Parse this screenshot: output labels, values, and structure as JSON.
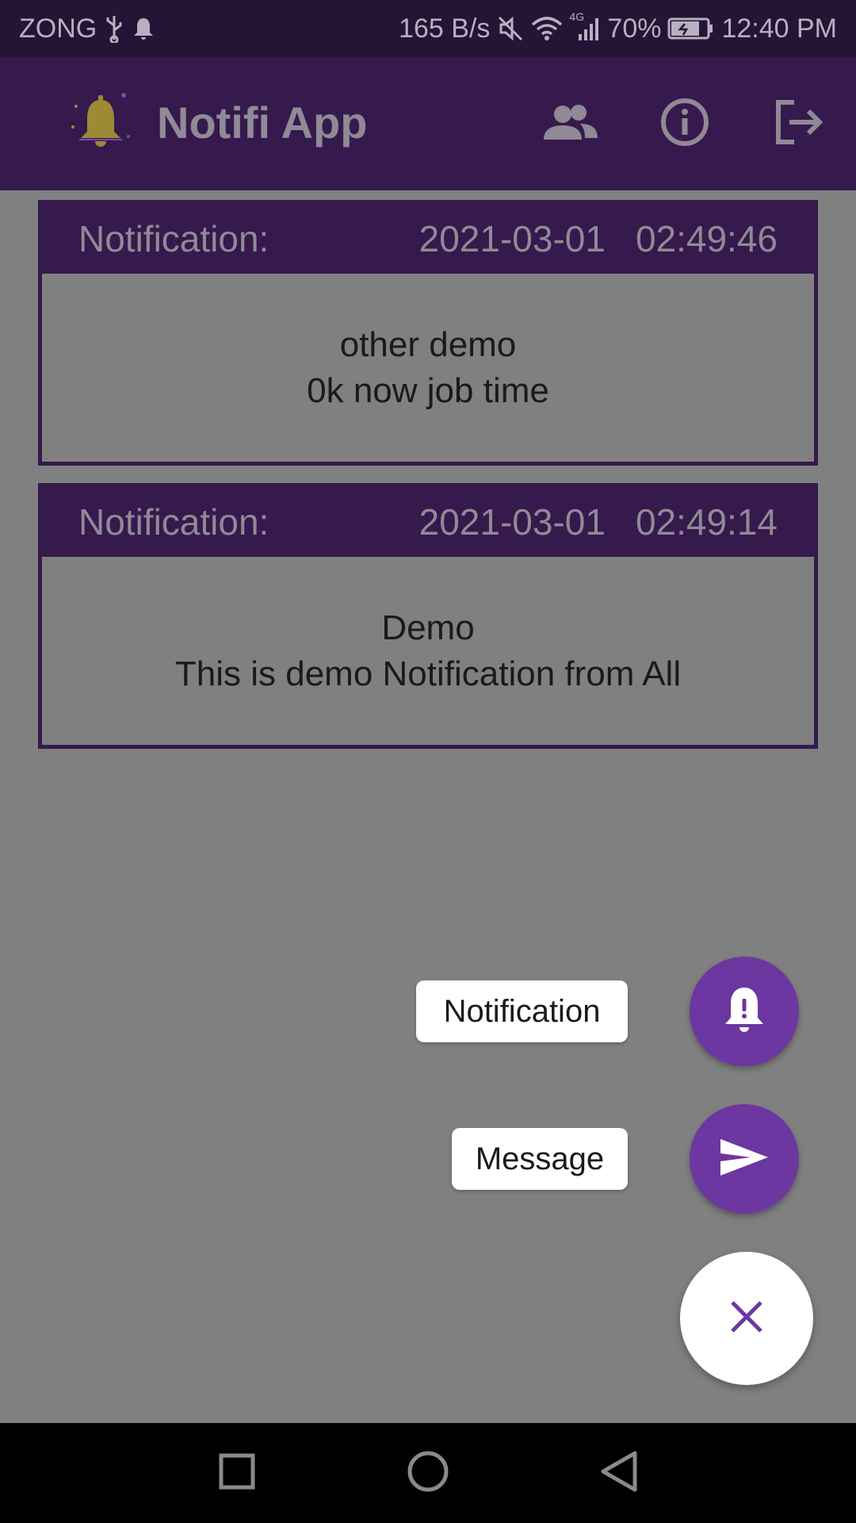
{
  "status_bar": {
    "carrier": "ZONG",
    "net_speed": "165 B/s",
    "network_type": "4G",
    "battery": "70%",
    "time": "12:40 PM"
  },
  "app_bar": {
    "title": "Notifi App",
    "actions": [
      "people-icon",
      "info-icon",
      "logout-icon"
    ]
  },
  "notifications": [
    {
      "label": "Notification:",
      "date": "2021-03-01",
      "time": "02:49:46",
      "title": "other demo",
      "body": "0k now job time"
    },
    {
      "label": "Notification:",
      "date": "2021-03-01",
      "time": "02:49:14",
      "title": "Demo",
      "body": "This is demo Notification from All"
    }
  ],
  "speed_dial": {
    "notification_label": "Notification",
    "message_label": "Message",
    "notification_icon": "bell-icon",
    "message_icon": "send-icon",
    "main_icon": "close-icon"
  },
  "colors": {
    "primary": "#36194d",
    "accent": "#6c37a0",
    "scrim": "#808080"
  }
}
